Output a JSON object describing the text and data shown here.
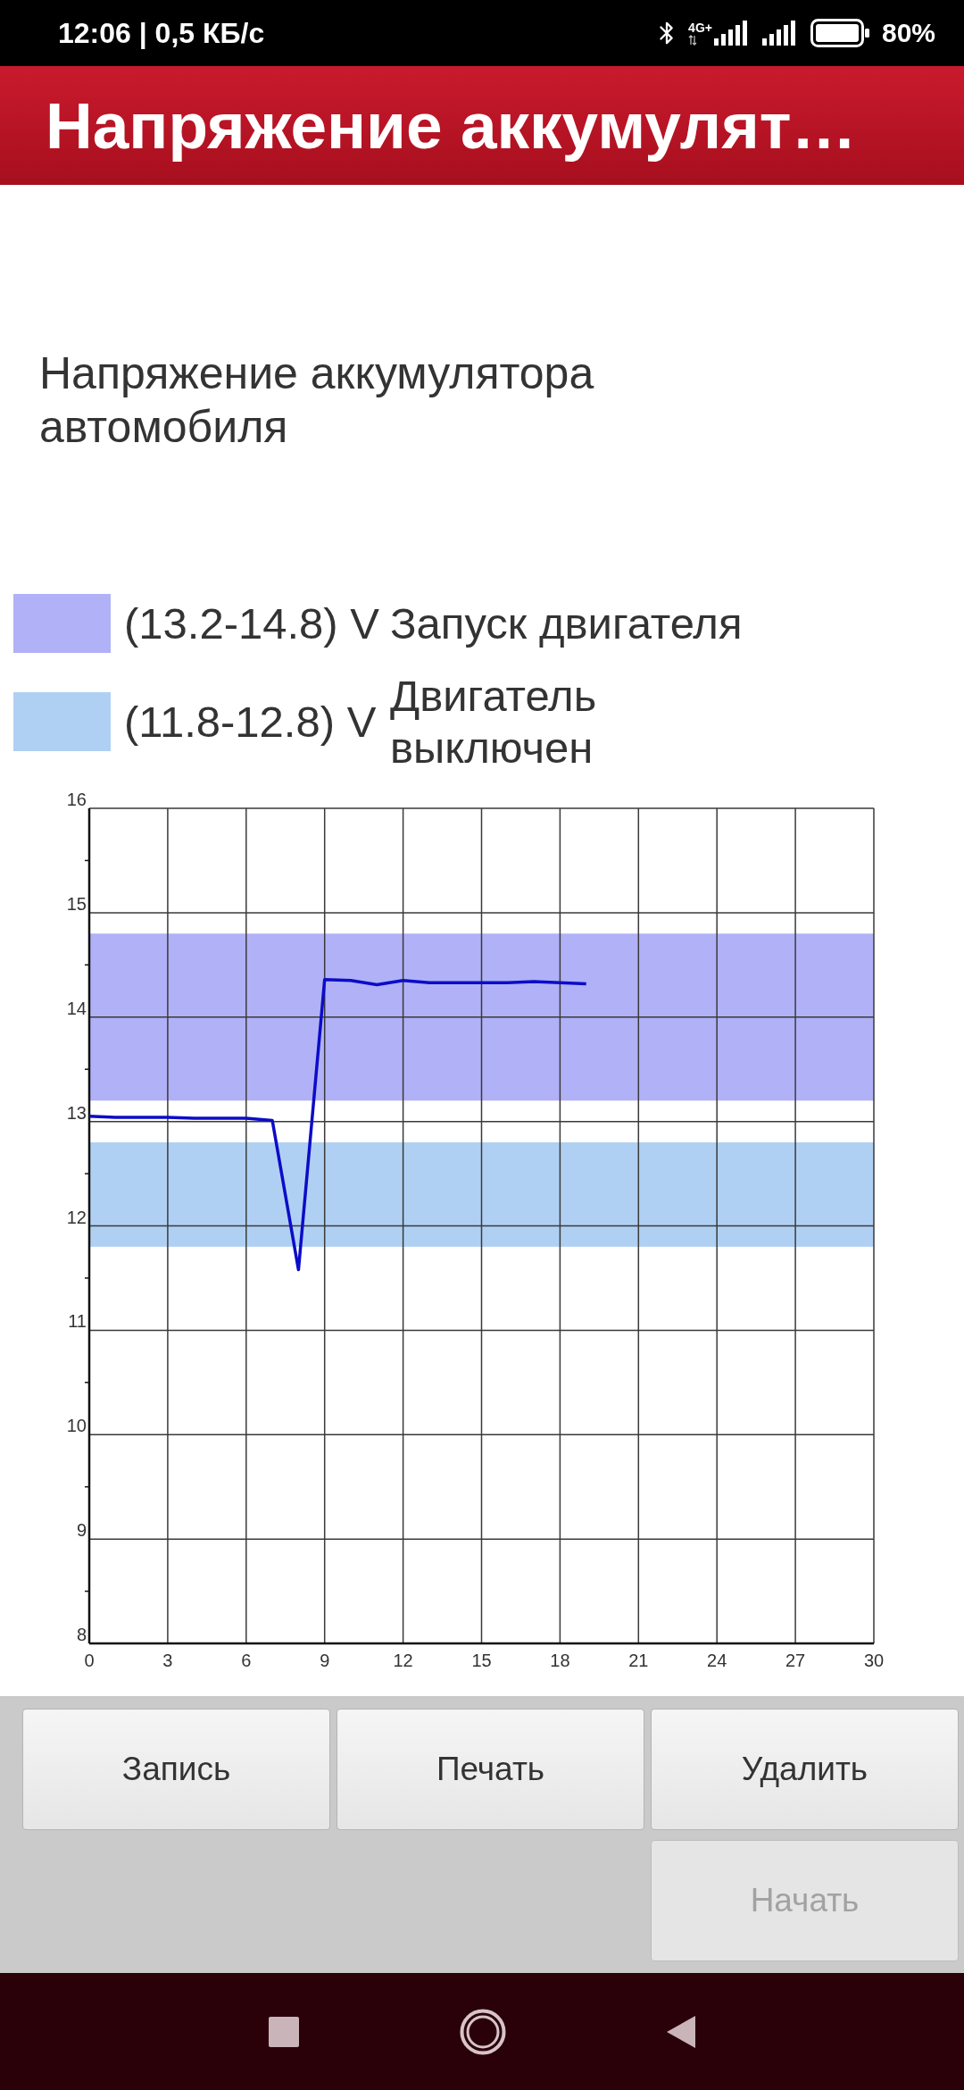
{
  "status_bar": {
    "time": "12:06 | 0,5 КБ/с",
    "network": "4G+",
    "battery": "80%"
  },
  "header": {
    "title": "Напряжение аккумулят…"
  },
  "subtitle": "Напряжение аккумулятора автомобиля",
  "legend": [
    {
      "color": "#b1b1f7",
      "range": "(13.2-14.8) V",
      "label": "Запуск двигателя"
    },
    {
      "color": "#b0d0f3",
      "range": "(11.8-12.8) V",
      "label": "Двигатель выключен"
    }
  ],
  "chart": {
    "chart_data": {
      "type": "line",
      "x": [
        0,
        1,
        2,
        3,
        4,
        5,
        6,
        7,
        8,
        9,
        10,
        11,
        12,
        13,
        14,
        15,
        16,
        17,
        18,
        19
      ],
      "series": [
        {
          "color": "#0c0cc8",
          "values": [
            13.05,
            13.04,
            13.04,
            13.04,
            13.03,
            13.03,
            13.03,
            13.01,
            11.58,
            14.36,
            14.35,
            14.31,
            14.35,
            14.33,
            14.33,
            14.33,
            14.33,
            14.34,
            14.33,
            14.32
          ]
        }
      ],
      "xlim": [
        0,
        30
      ],
      "ylim": [
        8,
        16
      ],
      "xticks": [
        0,
        3,
        6,
        9,
        12,
        15,
        18,
        21,
        24,
        27,
        30
      ],
      "yticks": [
        8,
        9,
        10,
        11,
        12,
        13,
        14,
        15,
        16
      ],
      "grid": true,
      "bands": [
        {
          "axis": "y",
          "from": 13.2,
          "to": 14.8,
          "color": "#b1b1f7"
        },
        {
          "axis": "y",
          "from": 11.8,
          "to": 12.8,
          "color": "#b0d0f3"
        }
      ]
    }
  },
  "button_rows": [
    [
      {
        "label": "Запись",
        "disabled": false
      },
      {
        "label": "Печать",
        "disabled": false
      },
      {
        "label": "Удалить",
        "disabled": false
      }
    ],
    [
      {
        "label": "Начать",
        "disabled": true
      }
    ]
  ]
}
